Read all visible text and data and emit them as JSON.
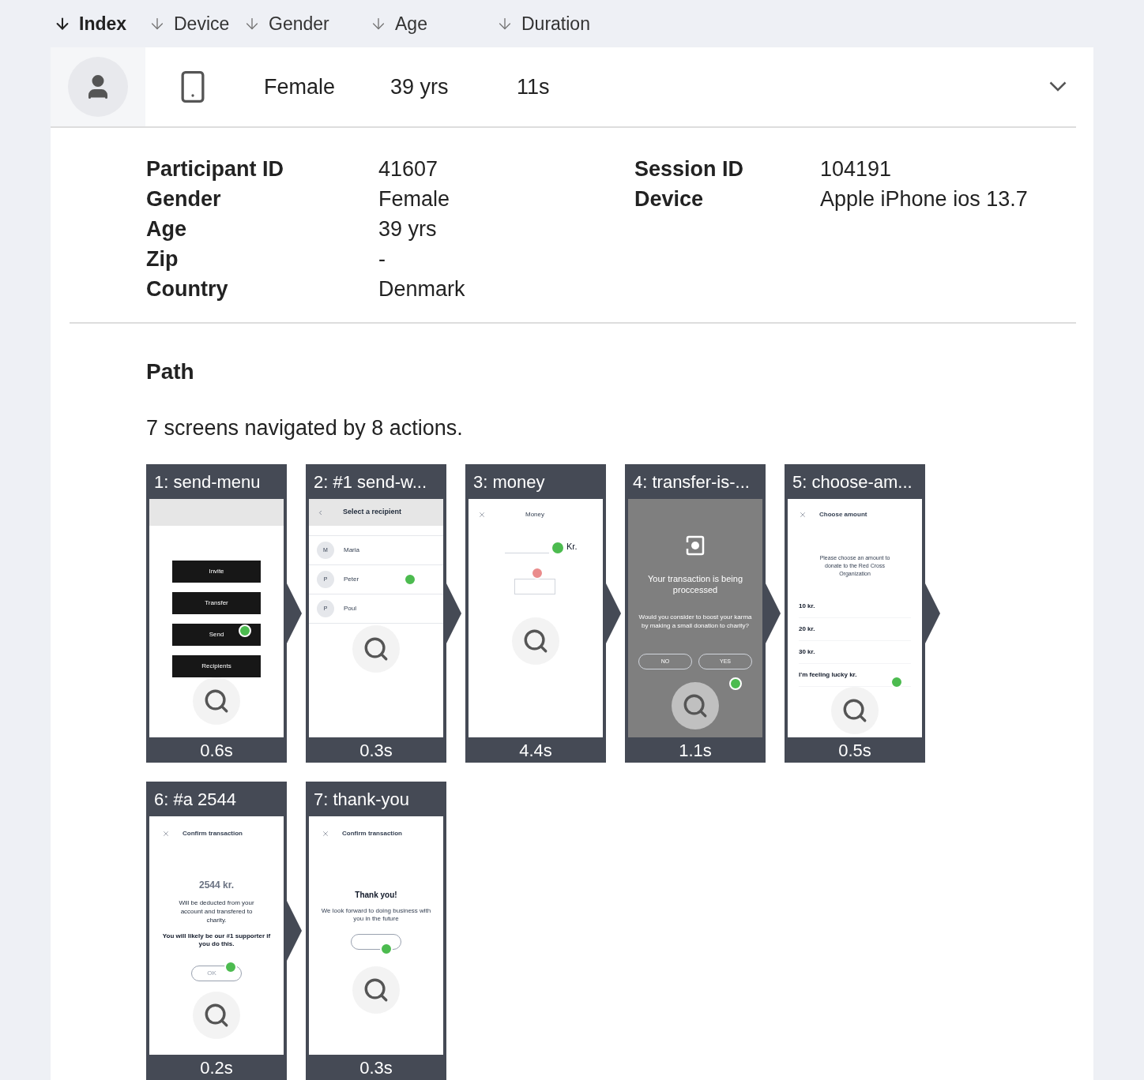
{
  "columns": [
    {
      "label": "Index",
      "selected": true
    },
    {
      "label": "Device",
      "selected": false
    },
    {
      "label": "Gender",
      "selected": false
    },
    {
      "label": "Age",
      "selected": false
    },
    {
      "label": "Duration",
      "selected": false
    }
  ],
  "session": {
    "gender": "Female",
    "age": "39 yrs",
    "duration": "11s",
    "expanded": true
  },
  "details_left": [
    {
      "label": "Participant ID",
      "value": "41607"
    },
    {
      "label": "Gender",
      "value": "Female"
    },
    {
      "label": "Age",
      "value": "39 yrs"
    },
    {
      "label": "Zip",
      "value": "-"
    },
    {
      "label": "Country",
      "value": "Denmark"
    }
  ],
  "details_right": [
    {
      "label": "Session ID",
      "value": "104191"
    },
    {
      "label": "Device",
      "value": "Apple iPhone ios 13.7"
    }
  ],
  "path": {
    "title": "Path",
    "summary": "7 screens navigated by 8 actions.",
    "screens": [
      {
        "kind": "menu",
        "title": "1: send-menu",
        "duration": "0.6s",
        "buttons": [
          "Invite",
          "Transfer",
          "Send",
          "Recipients"
        ]
      },
      {
        "kind": "list",
        "title": "2: #1 send-w...",
        "duration": "0.3s",
        "heading": "Select a recipient",
        "rows": [
          {
            "initial": "M",
            "name": "Maria"
          },
          {
            "initial": "P",
            "name": "Peter"
          },
          {
            "initial": "P",
            "name": "Poul"
          }
        ]
      },
      {
        "kind": "amount",
        "title": "3: money",
        "duration": "4.4s",
        "heading": "Money",
        "unit": "Kr."
      },
      {
        "kind": "processing",
        "title": "4: transfer-is-...",
        "duration": "1.1s",
        "message": "Your transaction is being proccessed",
        "question": "Would you consider to boost your karma by making a small donation to charity?",
        "buttons": [
          "NO",
          "YES"
        ]
      },
      {
        "kind": "options",
        "title": "5: choose-am...",
        "duration": "0.5s",
        "heading": "Choose amount",
        "message": "Please choose an amount to donate to the Red Cross Organization",
        "options": [
          "10 kr.",
          "20 kr.",
          "30 kr.",
          "I'm feeling lucky kr."
        ]
      },
      {
        "kind": "confirm",
        "title": "6: #a 2544",
        "duration": "0.2s",
        "heading": "Confirm transaction",
        "amount": "2544 kr.",
        "message": "Will be deducted from your account and transfered to charity.",
        "note": "You will likely be our #1 supporter if you do this.",
        "button": "OK"
      },
      {
        "kind": "thanks",
        "title": "7: thank-you",
        "duration": "0.3s",
        "heading": "Confirm transaction",
        "message": "Thank you!",
        "note": "We look forward to doing business with you in the future"
      }
    ]
  }
}
